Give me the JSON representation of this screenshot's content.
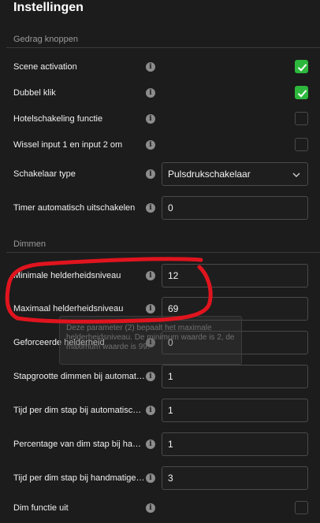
{
  "page": {
    "title": "Instellingen"
  },
  "sections": {
    "buttons": "Gedrag knoppen",
    "dimming": "Dimmen"
  },
  "settings": {
    "scene_activation": {
      "label": "Scene activation",
      "checked": true
    },
    "double_click": {
      "label": "Dubbel klik",
      "checked": true
    },
    "hotel_switching": {
      "label": "Hotelschakeling functie",
      "checked": false
    },
    "swap_inputs": {
      "label": "Wissel input 1 en input 2 om",
      "checked": false
    },
    "switch_type": {
      "label": "Schakelaar type",
      "value": "Pulsdrukschakelaar"
    },
    "auto_off_timer": {
      "label": "Timer automatisch uitschakelen",
      "value": "0"
    },
    "min_brightness": {
      "label": "Minimale helderheidsniveau",
      "value": "12"
    },
    "max_brightness": {
      "label": "Maximaal helderheidsniveau",
      "value": "69"
    },
    "forced_brightness": {
      "label": "Geforceerde helderheid",
      "value": "0"
    },
    "auto_dim_step_size": {
      "label": "Stapgrootte dimmen bij automatische dimfunctie",
      "value": "1"
    },
    "auto_dim_step_time": {
      "label": "Tijd per dim stap bij automatische dimfunctie",
      "value": "1"
    },
    "manual_dim_step_pct": {
      "label": "Percentage van dim stap bij handmatige dimfunctie",
      "value": "1"
    },
    "manual_dim_step_time": {
      "label": "Tijd per dim stap bij handmatige bediening",
      "value": "3"
    },
    "dim_function_off": {
      "label": "Dim functie uit",
      "checked": false
    }
  },
  "tooltip": {
    "text": "Deze parameter (2) bepaalt het maximale helderheidsniveau. De minimum waarde is 2, de maximum waarde is 99."
  },
  "icons": {
    "info": "info-icon",
    "check": "checkmark-icon",
    "chevron": "chevron-down-icon"
  },
  "colors": {
    "background": "#1c1c1c",
    "checked": "#2db83d",
    "annotation": "#e0141e"
  }
}
